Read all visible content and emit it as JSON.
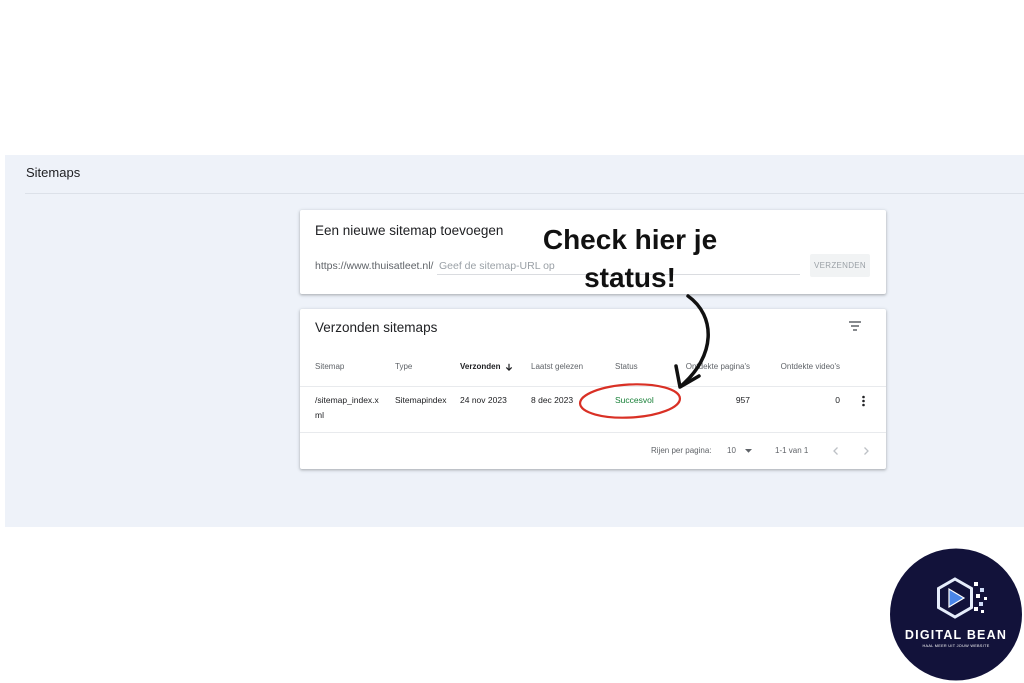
{
  "colors": {
    "page_background": "#ffffff",
    "panel_background": "#eef2f9",
    "text_primary": "#202124",
    "text_secondary": "#5f6368",
    "status_success": "#188038",
    "annotation_red": "#d93025",
    "annotation_ink": "#111111",
    "logo_background": "#12123a",
    "logo_accent": "#4a86e8"
  },
  "page": {
    "title": "Sitemaps"
  },
  "add_sitemap": {
    "title": "Een nieuwe sitemap toevoegen",
    "url_prefix": "https://www.thuisatleet.nl/",
    "input_placeholder": "Geef de sitemap-URL op",
    "submit_label": "VERZENDEN",
    "submit_disabled": true
  },
  "submitted_sitemaps": {
    "title": "Verzonden sitemaps",
    "filter_icon": "filter-icon",
    "sort_icon": "arrow-down-icon",
    "sorted_column_index": 2,
    "columns": [
      "Sitemap",
      "Type",
      "Verzonden",
      "Laatst gelezen",
      "Status",
      "Ontdekte pagina's",
      "Ontdekte video's"
    ],
    "rows": [
      {
        "sitemap": "/sitemap_index.xml",
        "type": "Sitemapindex",
        "submitted": "24 nov 2023",
        "last_read": "8 dec 2023",
        "status": "Succesvol",
        "discovered_pages": 957,
        "discovered_videos": 0,
        "menu_icon": "more-vert-icon"
      }
    ],
    "pagination": {
      "rows_per_page_label": "Rijen per pagina:",
      "rows_per_page": "10",
      "range": "1-1 van 1",
      "prev_icon": "chevron-left-icon",
      "next_icon": "chevron-right-icon"
    }
  },
  "annotation": {
    "callout": "Check hier je status!"
  },
  "logo": {
    "wordmark": "DIGITAL BEAN",
    "tagline": "HAAL MEER UIT JOUW WEBSITE",
    "icon": "hexagon-play-icon"
  }
}
